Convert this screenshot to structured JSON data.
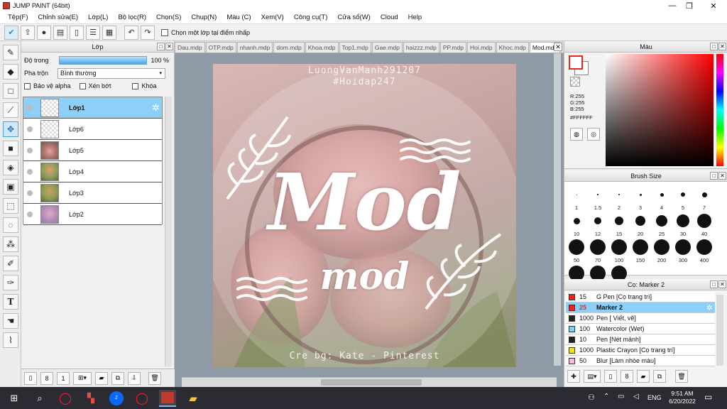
{
  "window": {
    "title": "JUMP PAINT (64bit)",
    "minimize": "—",
    "maximize": "❐",
    "close": "✕"
  },
  "menu": [
    "Tệp(F)",
    "Chỉnh sửa(E)",
    "Lớp(L)",
    "Bộ lọc(R)",
    "Chọn(S)",
    "Chụp(N)",
    "Màu (C)",
    "Xem(V)",
    "Công cụ(T)",
    "Cửa sổ(W)",
    "Cloud",
    "Help"
  ],
  "toolbar": {
    "checkbox_label": "Chọn một lớp tại điểm nhấp"
  },
  "layer_panel": {
    "title": "Lớp",
    "opacity_label": "Độ trong",
    "opacity_value": "100 %",
    "opacity": 1.0,
    "blend_label": "Pha trộn",
    "blend_value": "Bình thường",
    "protect_alpha": "Bảo vệ alpha",
    "clip": "Xén bớt",
    "lock": "Khóa",
    "layers": [
      {
        "name": "Lớp1",
        "selected": true,
        "thumb": "blank"
      },
      {
        "name": "Lớp6",
        "selected": false,
        "thumb": "blank"
      },
      {
        "name": "Lớp5",
        "selected": false,
        "thumb": "pink"
      },
      {
        "name": "Lớp4",
        "selected": false,
        "thumb": "green"
      },
      {
        "name": "Lớp3",
        "selected": false,
        "thumb": "green"
      },
      {
        "name": "Lớp2",
        "selected": false,
        "thumb": "purple"
      }
    ]
  },
  "tabs": [
    "Dau.mdp",
    "OTP.mdp",
    "nhanh.mdp",
    "dom.mdp",
    "Khoa.mdp",
    "Top1.mdp",
    "Gae.mdp",
    "haizzz.mdp",
    "PP.mdp",
    "Hoi.mdp",
    "Khoc.mdp",
    "Mod.mdp"
  ],
  "artwork": {
    "watermark1": "LuongVanManh291207",
    "watermark2": "#Hoidap247",
    "big_text": "Mod",
    "small_text": "mod",
    "credit": "Cre bg: Kate - Pinterest"
  },
  "color_panel": {
    "title": "Màu",
    "r": "R:255",
    "g": "G:255",
    "b": "B:255",
    "hex": "#FFFFFF",
    "fg": "#e8271f",
    "bg": "#ffffff"
  },
  "brush_panel": {
    "title": "Brush Size",
    "sizes": [
      "1",
      "1.5",
      "2",
      "3",
      "4",
      "5",
      "7",
      "10",
      "12",
      "15",
      "20",
      "25",
      "30",
      "40",
      "50",
      "70",
      "100",
      "150",
      "200",
      "300",
      "400",
      "",
      "",
      ""
    ]
  },
  "marker_panel": {
    "title": "Cọ: Marker 2",
    "items": [
      {
        "size": "15",
        "name": "G Pen [Cọ trang trí]",
        "color": "#e8271f",
        "selected": false
      },
      {
        "size": "25",
        "name": "Marker 2",
        "color": "#e8271f",
        "selected": true
      },
      {
        "size": "1000",
        "name": "Pen [ Viết, vẽ]",
        "color": "#222222",
        "selected": false
      },
      {
        "size": "100",
        "name": "Watercolor (Wet)",
        "color": "#7fd3ee",
        "selected": false
      },
      {
        "size": "10",
        "name": "Pen [Nét mảnh]",
        "color": "#222222",
        "selected": false
      },
      {
        "size": "1000",
        "name": "Plastic Crayon [Cọ trang trí]",
        "color": "#f4e21a",
        "selected": false
      },
      {
        "size": "50",
        "name": "Blur [Làm nhòe màu]",
        "color": "#f7b9d6",
        "selected": false
      }
    ]
  },
  "taskbar": {
    "lang": "ENG",
    "time": "9:51 AM",
    "date": "6/20/2022"
  }
}
